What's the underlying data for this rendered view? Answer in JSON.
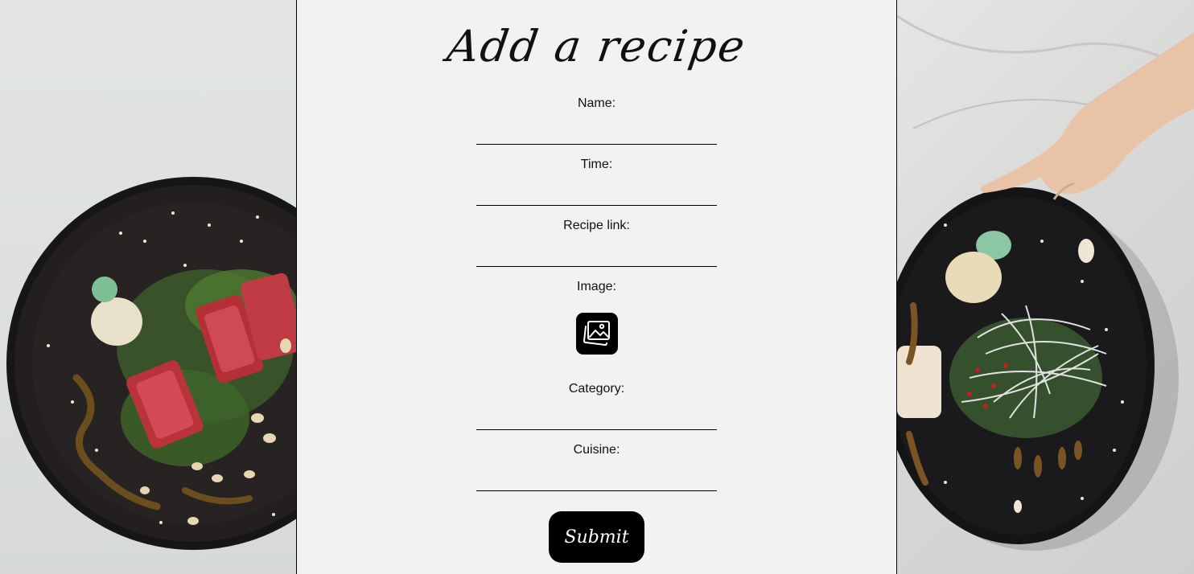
{
  "page": {
    "title": "Add a recipe"
  },
  "form": {
    "name_label": "Name:",
    "name_value": "",
    "time_label": "Time:",
    "time_value": "",
    "recipe_link_label": "Recipe link:",
    "recipe_link_value": "",
    "image_label": "Image:",
    "image_icon": "image-upload-icon",
    "category_label": "Category:",
    "category_value": "",
    "cuisine_label": "Cuisine:",
    "cuisine_value": "",
    "submit_label": "Submit"
  },
  "colors": {
    "panel_bg": "#f2f2f2",
    "button_bg": "#000000",
    "button_text": "#ffffff",
    "plate": "#1c1c1e"
  }
}
